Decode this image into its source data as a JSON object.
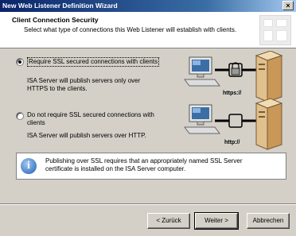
{
  "window": {
    "title": "New Web Listener Definition Wizard",
    "close_label": "×"
  },
  "header": {
    "title": "Client Connection Security",
    "description": "Select what type of connections this Web Listener will establish with clients."
  },
  "options": [
    {
      "label": "Require SSL secured connections with clients",
      "selected": true,
      "description_lines": [
        "ISA Server will publish servers only over",
        "HTTPS to the clients."
      ],
      "protocol_label": "https://"
    },
    {
      "label_lines": [
        "Do not require SSL secured connections with",
        "clients"
      ],
      "selected": false,
      "description_lines": [
        "ISA Server will publish servers over HTTP."
      ],
      "protocol_label": "http://"
    }
  ],
  "info": {
    "icon": "info-icon",
    "lines": [
      "Publishing over SSL requires that an appropriately named SSL Server",
      "certificate is installed on the ISA Server computer."
    ]
  },
  "buttons": {
    "back": "< Zurück",
    "next": "Weiter >",
    "cancel": "Abbrechen"
  },
  "colors": {
    "titlebar_start": "#0a246a",
    "titlebar_end": "#a6caf0",
    "dialog_bg": "#d4d0c8"
  }
}
